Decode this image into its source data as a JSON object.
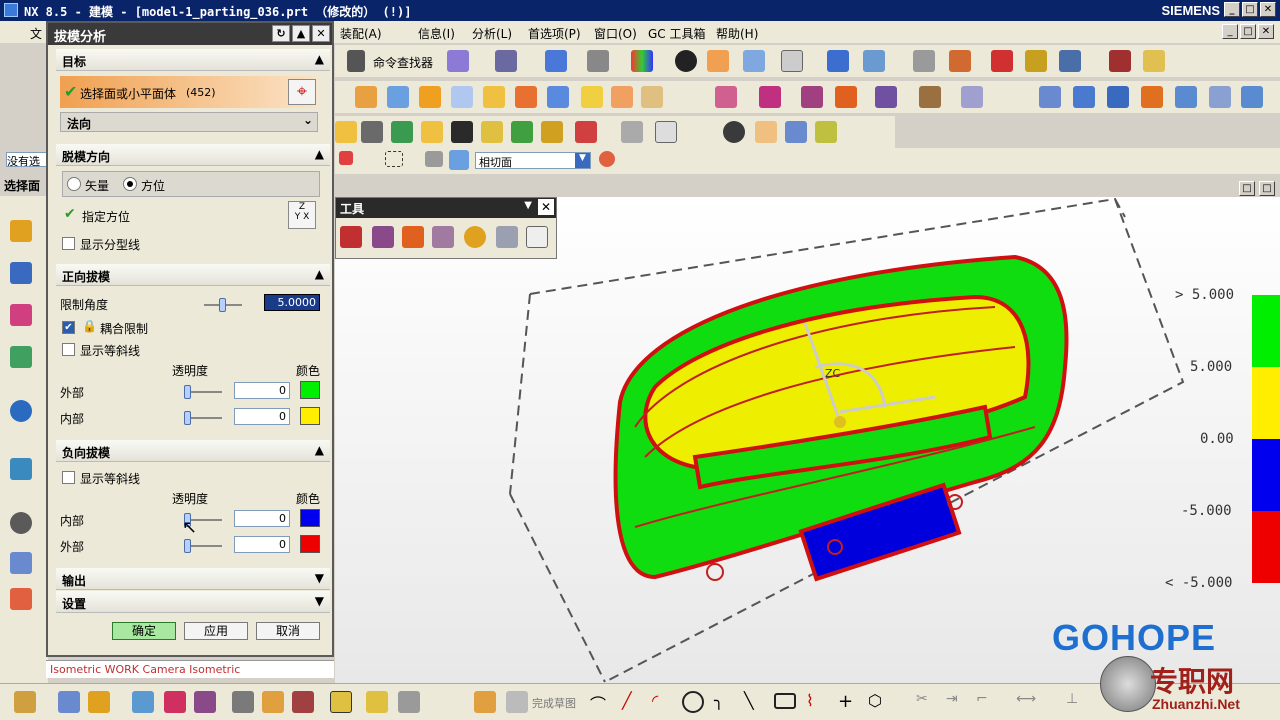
{
  "window": {
    "title": "NX 8.5 - 建模 - [model-1_parting_036.prt （修改的）    (!)]",
    "brand": "SIEMENS"
  },
  "menu": {
    "file": "文",
    "assembly": "装配(A)",
    "info": "信息(I)",
    "analysis": "分析(L)",
    "prefs": "首选项(P)",
    "window": "窗口(O)",
    "gc": "GC 工具箱",
    "help": "帮助(H)"
  },
  "toolbar": {
    "command_finder": "命令查找器",
    "face_filter": "相切面",
    "not_selected": "没有选",
    "select_face": "选择面",
    "finish_sketch": "完成草图"
  },
  "dialog": {
    "title": "拔模分析",
    "target": {
      "header": "目标",
      "select_label": "选择面或小平面体",
      "select_count": "(452)",
      "mode": "法向"
    },
    "draw_dir": {
      "header": "脱模方向",
      "radio_vector": "矢量",
      "radio_orient": "方位",
      "orient_label": "指定方位",
      "parting_line": "显示分型线"
    },
    "pos": {
      "header": "正向拔模",
      "limit_label": "限制角度",
      "limit_value": "5.0000",
      "coupled": "耦合限制",
      "isoclines": "显示等斜线",
      "transparency": "透明度",
      "color": "颜色",
      "outside": "外部",
      "inside": "内部",
      "outside_val": "0",
      "inside_val": "0",
      "outside_color": "#00ee00",
      "inside_color": "#ffee00"
    },
    "neg": {
      "header": "负向拔模",
      "isoclines": "显示等斜线",
      "transparency": "透明度",
      "color": "颜色",
      "inside": "内部",
      "outside": "外部",
      "inside_val": "0",
      "outside_val": "0",
      "inside_color": "#0000ee",
      "outside_color": "#ee0000"
    },
    "output": "输出",
    "settings": "设置",
    "ok": "确定",
    "apply": "应用",
    "cancel": "取消"
  },
  "status": "Isometric WORK Camera Isometric",
  "float_toolbar": {
    "title": "工具"
  },
  "legend": {
    "l1": "> 5.000",
    "l2": "5.000",
    "l3": "0.00",
    "l4": "-5.000",
    "l5": "< -5.000"
  },
  "viewport": {
    "csys_label": "ZC"
  },
  "watermark": {
    "logo": "GOHOPE",
    "site_cn": "专职网",
    "site_en": "Zhuanzhi.Net"
  }
}
